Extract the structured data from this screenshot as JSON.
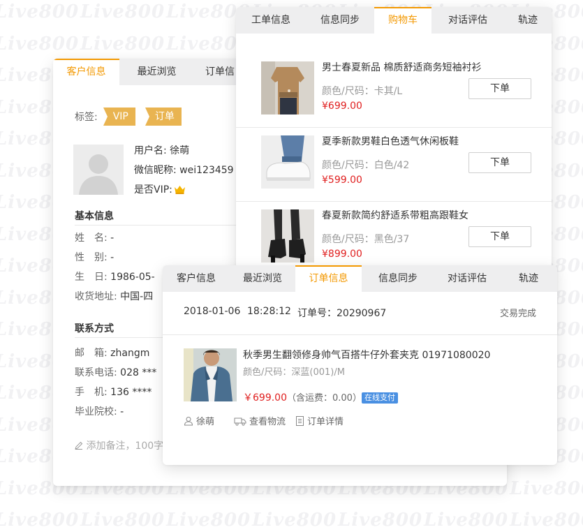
{
  "watermark": "Live800",
  "colors": {
    "accent": "#f39800",
    "price": "#e02020",
    "tag": "#e9b451",
    "badge": "#4a90e2"
  },
  "customer_panel": {
    "tabs": [
      {
        "label": "客户信息",
        "active": true
      },
      {
        "label": "最近浏览",
        "active": false
      },
      {
        "label": "订单信",
        "active": false
      }
    ],
    "tags_label": "标签:",
    "tags": [
      "VIP",
      "订单"
    ],
    "user": {
      "username_label": "用户名:",
      "username": "徐萌",
      "nickname_label": "微信昵称:",
      "nickname": "wei123459",
      "vip_label": "是否VIP:",
      "vip_icon": "crown-icon"
    },
    "basic_title": "基本信息",
    "basic_fields": [
      {
        "label": "姓　名:",
        "value": "-"
      },
      {
        "label": "性　别:",
        "value": "-"
      },
      {
        "label": "生　日:",
        "value": "1986-05-"
      },
      {
        "label": "收货地址:",
        "value": "中国-四"
      }
    ],
    "contact_title": "联系方式",
    "contact_fields": [
      {
        "label": "邮　箱:",
        "value": "zhangm"
      },
      {
        "label": "联系电话:",
        "value": "028 ***"
      },
      {
        "label": "手　机:",
        "value": "136 ****"
      },
      {
        "label": "毕业院校:",
        "value": "-"
      }
    ],
    "remark_placeholder": "添加备注，100字"
  },
  "cart_panel": {
    "tabs": [
      {
        "label": "工单信息",
        "active": false
      },
      {
        "label": "信息同步",
        "active": false
      },
      {
        "label": "购物车",
        "active": true
      },
      {
        "label": "对话评估",
        "active": false
      },
      {
        "label": "轨迹",
        "active": false
      }
    ],
    "items": [
      {
        "name": "男士春夏新品  棉质舒适商务短袖衬衫",
        "spec": "颜色/尺码：卡其/L",
        "price": "¥699.00",
        "button": "下单"
      },
      {
        "name": "夏季新款男鞋白色透气休闲板鞋",
        "spec": "颜色/尺码：白色/42",
        "price": "¥599.00",
        "button": "下单"
      },
      {
        "name": "春夏新款简约舒适系带粗高跟鞋女",
        "spec": "颜色/尺码：黑色/37",
        "price": "¥899.00",
        "button": "下单"
      }
    ]
  },
  "order_panel": {
    "tabs": [
      {
        "label": "客户信息",
        "active": false
      },
      {
        "label": "最近浏览",
        "active": false
      },
      {
        "label": "订单信息",
        "active": true
      },
      {
        "label": "信息同步",
        "active": false
      },
      {
        "label": "对话评估",
        "active": false
      },
      {
        "label": "轨迹",
        "active": false
      }
    ],
    "date": "2018-01-06",
    "time": "18:28:12",
    "order_no": "订单号：20290967",
    "status": "交易完成",
    "product_name": "秋季男生翻领修身帅气百搭牛仔外套夹克   01971080020",
    "product_spec": "颜色/尺码：深蓝(001)/M",
    "price": "￥699.00",
    "shipping": "（含运费：0.00）",
    "pay_badge": "在线支付",
    "actions": [
      {
        "icon": "user-icon",
        "label": "徐萌"
      },
      {
        "icon": "truck-icon",
        "label": "查看物流"
      },
      {
        "icon": "document-icon",
        "label": "订单详情"
      }
    ]
  }
}
